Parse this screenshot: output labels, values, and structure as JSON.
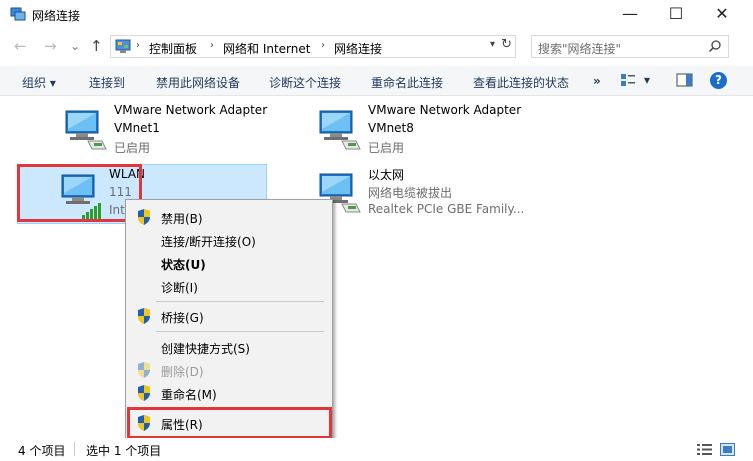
{
  "window": {
    "title": "网络连接",
    "minimize": "—",
    "maximize": "☐",
    "close": "✕"
  },
  "address": {
    "back": "←",
    "forward": "→",
    "recent": "⌄",
    "up": "↑",
    "breadcrumbs": [
      "控制面板",
      "网络和 Internet",
      "网络连接"
    ],
    "search_placeholder": "搜索\"网络连接\""
  },
  "toolbar": {
    "organize": "组织 ▾",
    "connect_to": "连接到",
    "disable_device": "禁用此网络设备",
    "diagnose": "诊断这个连接",
    "rename": "重命名此连接",
    "view_status": "查看此连接的状态",
    "more": "»",
    "view_dropdown": "▾",
    "help": "?"
  },
  "connections": [
    {
      "name": "VMware Network Adapter",
      "device": "VMnet1",
      "status": "已启用"
    },
    {
      "name": "VMware Network Adapter",
      "device": "VMnet8",
      "status": "已启用"
    },
    {
      "name": "WLAN",
      "device": "111",
      "status": "Intel"
    },
    {
      "name": "以太网",
      "device": "网络电缆被拔出",
      "status": "Realtek PCIe GBE Family..."
    }
  ],
  "context_menu": {
    "items": [
      {
        "label": "禁用(B)"
      },
      {
        "label": "连接/断开连接(O)"
      },
      {
        "label": "状态(U)"
      },
      {
        "label": "诊断(I)"
      },
      {
        "label": "桥接(G)"
      },
      {
        "label": "创建快捷方式(S)"
      },
      {
        "label": "删除(D)"
      },
      {
        "label": "重命名(M)"
      },
      {
        "label": "属性(R)"
      }
    ]
  },
  "statusbar": {
    "count": "4 个项目",
    "selected": "选中 1 个项目"
  }
}
